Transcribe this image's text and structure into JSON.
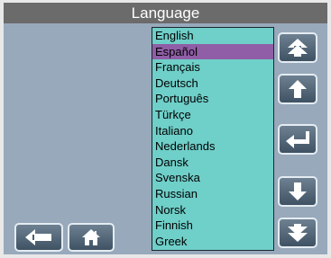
{
  "window": {
    "title": "Language"
  },
  "languages": {
    "items": [
      "English",
      "Español",
      "Français",
      "Deutsch",
      "Português",
      "Türkçe",
      "Italiano",
      "Nederlands",
      "Dansk",
      "Svenska",
      "Russian",
      "Norsk",
      "Finnish",
      "Greek"
    ],
    "selected": "Español"
  },
  "buttons": {
    "scroll_top": {
      "icon": "double-arrow-up-icon"
    },
    "move_up": {
      "icon": "arrow-up-icon"
    },
    "enter": {
      "icon": "enter-icon"
    },
    "move_down": {
      "icon": "arrow-down-icon"
    },
    "scroll_bottom": {
      "icon": "double-arrow-down-icon"
    },
    "back": {
      "icon": "arrow-left-icon"
    },
    "home": {
      "icon": "home-icon"
    }
  },
  "colors": {
    "background": "#98a9bb",
    "titlebar": "#6b6b6b",
    "list_background": "#6fcfc9",
    "selection": "#8f5ea6",
    "button": "#4b5e6f"
  }
}
